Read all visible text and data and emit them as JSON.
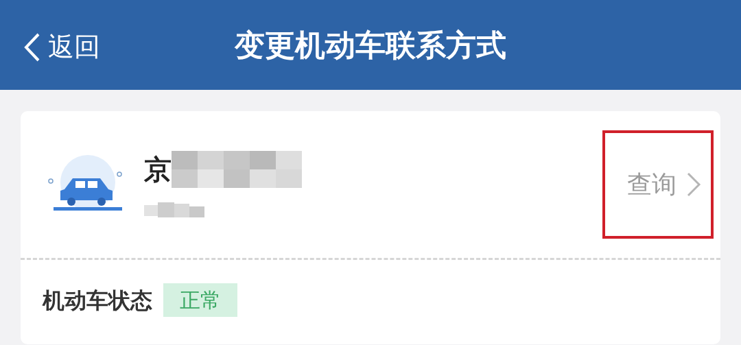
{
  "header": {
    "back_label": "返回",
    "title": "变更机动车联系方式"
  },
  "vehicle": {
    "plate": "京",
    "action": {
      "label": "查询",
      "highlighted": true
    }
  },
  "status": {
    "label": "机动车状态",
    "value": "正常"
  }
}
